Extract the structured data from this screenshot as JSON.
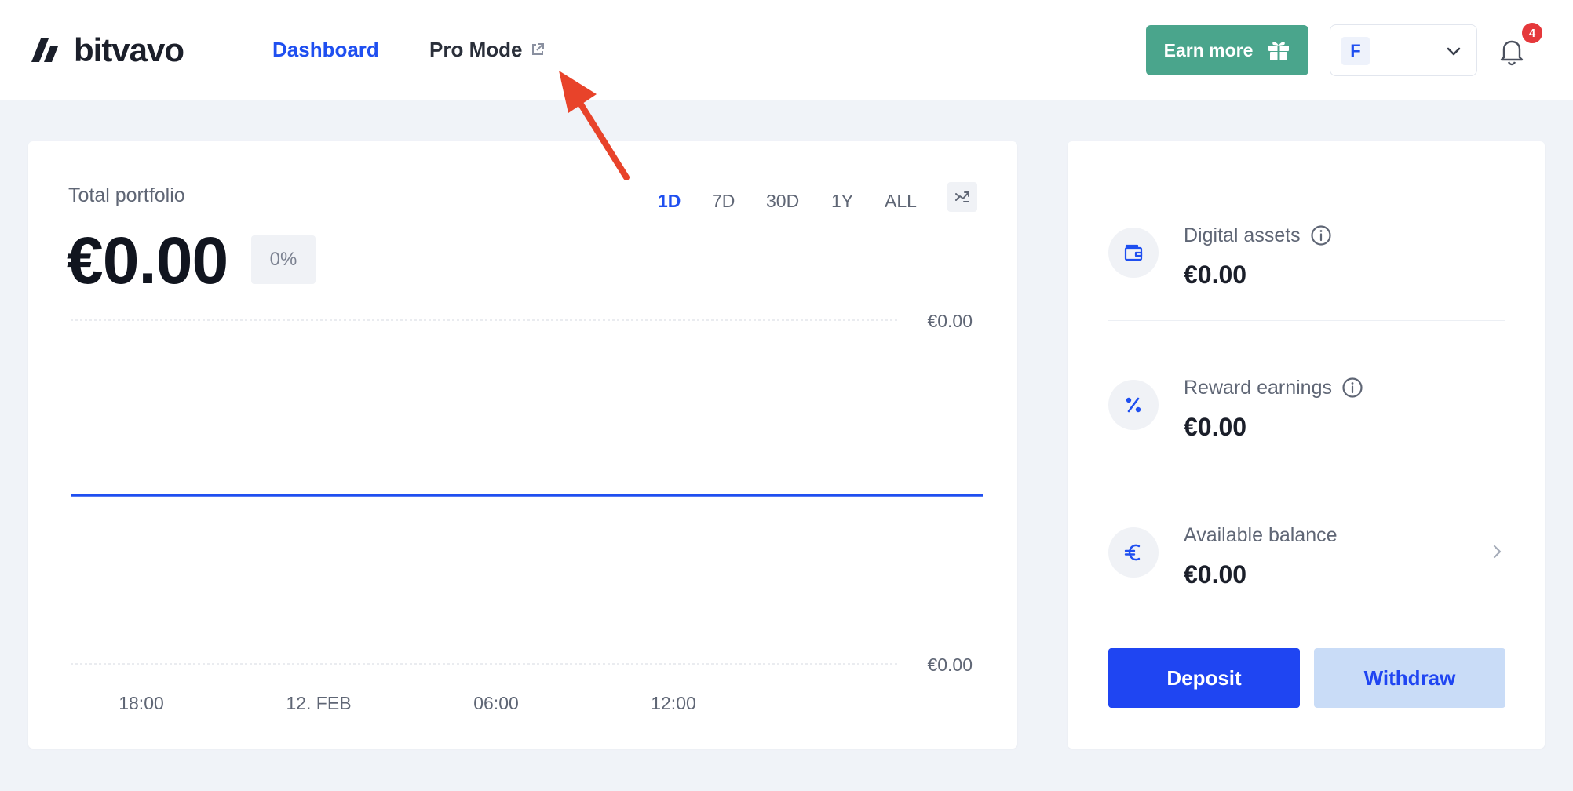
{
  "brand": {
    "name": "bitvavo"
  },
  "nav": {
    "dashboard_label": "Dashboard",
    "pro_mode_label": "Pro Mode"
  },
  "header": {
    "earn_label": "Earn more",
    "account_initial": "F",
    "notification_count": "4"
  },
  "portfolio": {
    "title": "Total portfolio",
    "value": "€0.00",
    "change": "0%",
    "ranges": [
      "1D",
      "7D",
      "30D",
      "1Y",
      "ALL"
    ],
    "active_range": "1D"
  },
  "chart_data": {
    "type": "line",
    "x": [
      "18:00",
      "12. FEB",
      "06:00",
      "12:00"
    ],
    "y_ticks": [
      "€0.00",
      "€0.00"
    ],
    "series": [
      {
        "values": [
          0,
          0,
          0,
          0
        ]
      }
    ],
    "grid": true,
    "color": "#1f4ff0"
  },
  "balances": [
    {
      "label": "Digital assets",
      "value": "€0.00",
      "icon": "wallet-icon",
      "info": true
    },
    {
      "label": "Reward earnings",
      "value": "€0.00",
      "icon": "percent-icon",
      "info": true
    },
    {
      "label": "Available balance",
      "value": "€0.00",
      "icon": "euro-icon",
      "info": false
    }
  ],
  "actions": {
    "deposit_label": "Deposit",
    "withdraw_label": "Withdraw"
  },
  "colors": {
    "accent": "#1f4ff0",
    "earn": "#4aa58c",
    "badge": "#e5383b",
    "annotation": "#e8432a"
  }
}
